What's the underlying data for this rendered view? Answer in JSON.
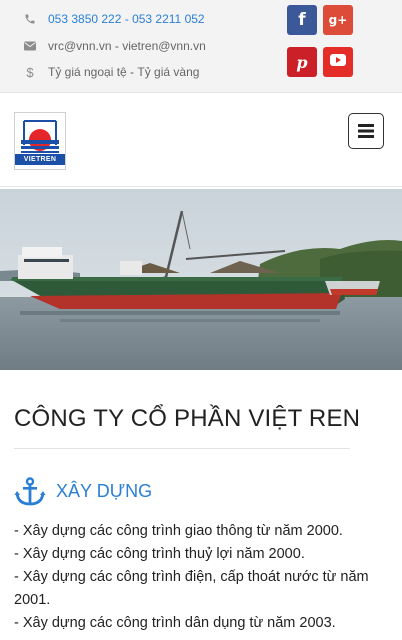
{
  "topbar": {
    "phone": "053 3850 222 - 053 2211 052",
    "email_1": "vrc@vnn.vn",
    "email_sep": " - ",
    "email_2": "vietren@vnn.vn",
    "rate_1": "Tỷ giá ngoại tệ",
    "rate_sep": " - ",
    "rate_2": "Tỷ giá vàng",
    "icons": [
      "phone-icon",
      "envelope-icon",
      "dollar-icon"
    ]
  },
  "social": {
    "facebook": "f",
    "google_plus": "g+",
    "pinterest": "p",
    "youtube": "youtube-icon"
  },
  "header": {
    "logo_text": "VIETREN",
    "menu_icon": "hamburger-icon"
  },
  "content": {
    "title": "CÔNG TY CỔ PHẦN VIỆT REN",
    "section_heading": "XÂY DỰNG",
    "items": [
      "- Xây dựng các công trình giao thông từ năm 2000.",
      "- Xây dựng các công trình thuỷ lợi năm 2000.",
      "- Xây dựng các công trình điện, cấp thoát nước từ năm 2001.",
      "- Xây dựng các công trình dân dụng từ năm 2003."
    ]
  },
  "colors": {
    "link_blue": "#2a7fd4",
    "facebook": "#3b5998",
    "google_plus": "#dd4b39",
    "pinterest": "#cb2027",
    "youtube": "#e52d27",
    "logo_blue": "#1c4fa8",
    "logo_red": "#e4262a"
  }
}
